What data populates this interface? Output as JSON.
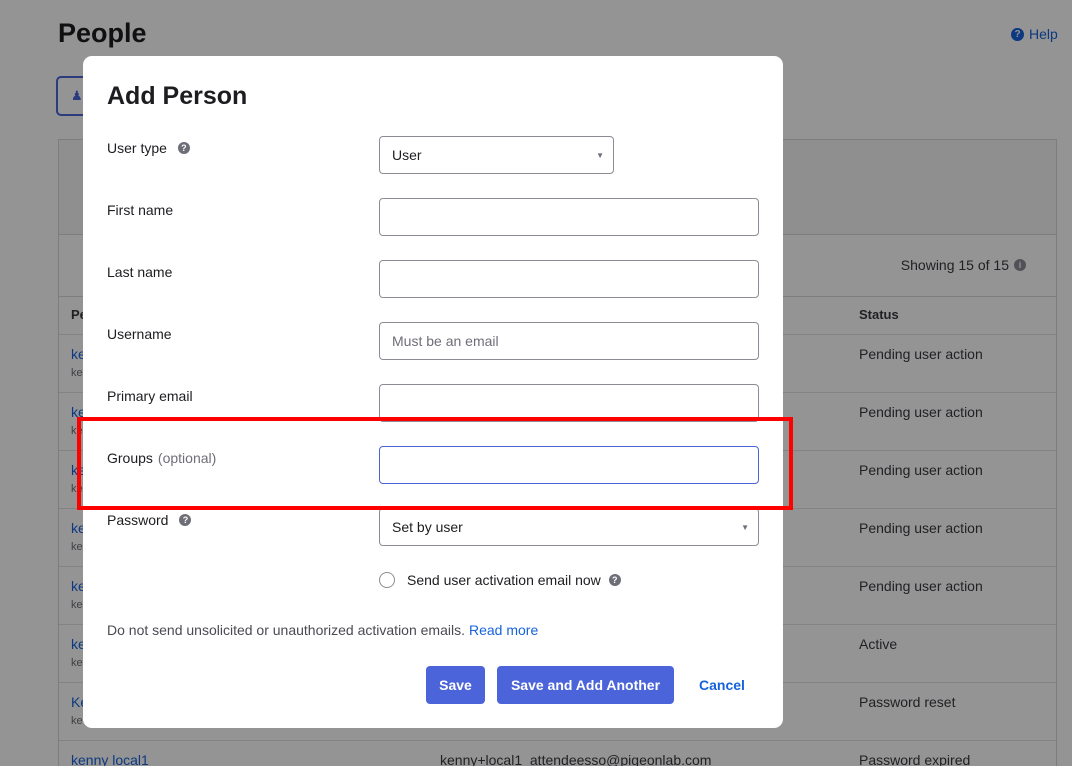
{
  "page": {
    "title": "People",
    "help_label": "Help",
    "showing": "Showing 15 of 15",
    "columns": {
      "person": "Pe",
      "status": "Status"
    },
    "rows": [
      {
        "name": "ke",
        "sub": "ke",
        "email": "",
        "status": "Pending user action"
      },
      {
        "name": "ke",
        "sub": "ke",
        "email": "",
        "status": "Pending user action"
      },
      {
        "name": "ke",
        "sub": "ke",
        "email": "",
        "status": "Pending user action"
      },
      {
        "name": "ke",
        "sub": "ke",
        "email": "",
        "status": "Pending user action"
      },
      {
        "name": "ke",
        "sub": "ke",
        "email": "",
        "status": "Pending user action"
      },
      {
        "name": "ke",
        "sub": "ke",
        "email": "",
        "status": "Active"
      },
      {
        "name": "Ke",
        "sub": "ke",
        "email": "",
        "status": "Password reset"
      },
      {
        "name": "kenny local1",
        "sub": "",
        "email": "kenny+local1_attendeesso@pigeonlab.com",
        "status": "Password expired"
      }
    ]
  },
  "modal": {
    "title": "Add Person",
    "fields": {
      "user_type": {
        "label": "User type",
        "value": "User"
      },
      "first_name": {
        "label": "First name",
        "value": "",
        "placeholder": ""
      },
      "last_name": {
        "label": "Last name",
        "value": "",
        "placeholder": ""
      },
      "username": {
        "label": "Username",
        "value": "",
        "placeholder": "Must be an email"
      },
      "primary_email": {
        "label": "Primary email",
        "value": "",
        "placeholder": ""
      },
      "groups": {
        "label": "Groups",
        "optional": "(optional)",
        "value": "",
        "placeholder": ""
      },
      "password": {
        "label": "Password",
        "value": "Set by user"
      }
    },
    "activation_checkbox": {
      "label": "Send user activation email now",
      "checked": false
    },
    "notice": {
      "text": "Do not send unsolicited or unauthorized activation emails.",
      "link": "Read more"
    },
    "buttons": {
      "save": "Save",
      "save_add_another": "Save and Add Another",
      "cancel": "Cancel"
    }
  },
  "colors": {
    "primary": "#4c64d9",
    "link": "#1662dd",
    "highlight": "#ff0000"
  }
}
